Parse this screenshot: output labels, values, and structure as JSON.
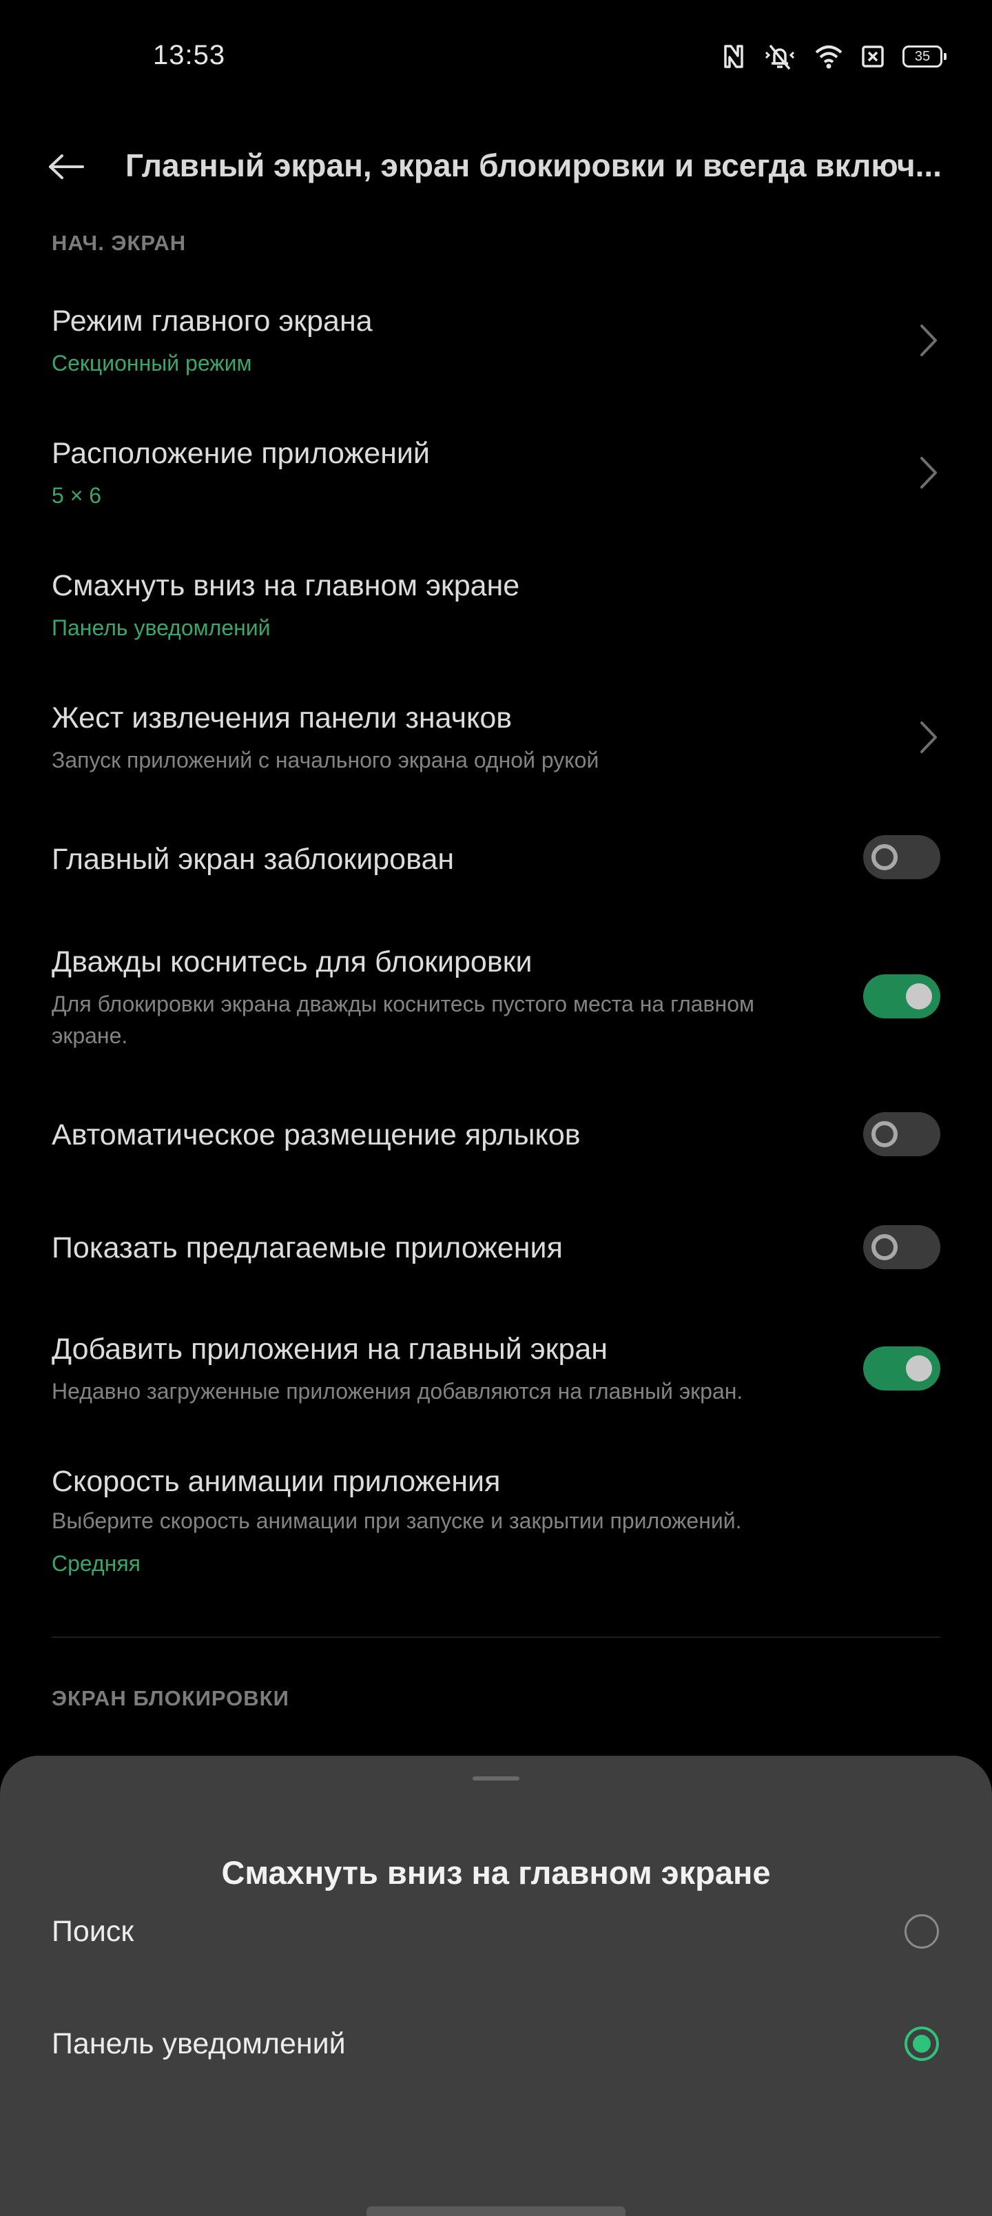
{
  "status_bar": {
    "time": "13:53",
    "battery": "35",
    "icons": [
      "nfc-icon",
      "silent-icon",
      "wifi-icon",
      "sim-error-icon",
      "battery-icon"
    ]
  },
  "header": {
    "back_icon": "arrow-left-icon",
    "title": "Главный экран, экран блокировки и всегда включ..."
  },
  "sections": {
    "home": "НАЧ. ЭКРАН",
    "lock": "ЭКРАН БЛОКИРОВКИ"
  },
  "settings": {
    "home_mode": {
      "title": "Режим главного экрана",
      "value": "Секционный режим"
    },
    "app_layout": {
      "title": "Расположение приложений",
      "value": "5 × 6"
    },
    "swipe_down": {
      "title": "Смахнуть вниз на главном экране",
      "value": "Панель уведомлений"
    },
    "icon_gesture": {
      "title": "Жест извлечения панели значков",
      "subtitle": "Запуск приложений с начального экрана одной рукой"
    },
    "home_locked": {
      "title": "Главный экран заблокирован",
      "enabled": false
    },
    "double_tap_lock": {
      "title": "Дважды коснитесь для блокировки",
      "subtitle": "Для блокировки экрана дважды коснитесь пустого места на главном экране.",
      "enabled": true
    },
    "auto_shortcuts": {
      "title": "Автоматическое размещение ярлыков",
      "enabled": false
    },
    "suggested_apps": {
      "title": "Показать предлагаемые приложения",
      "enabled": false
    },
    "add_to_home": {
      "title": "Добавить приложения на главный экран",
      "subtitle": "Недавно загруженные приложения добавляются на главный экран.",
      "enabled": true
    },
    "animation_speed": {
      "title": "Скорость анимации приложения",
      "subtitle": "Выберите скорость анимации при запуске и закрытии приложений.",
      "value": "Средняя"
    }
  },
  "sheet": {
    "title": "Смахнуть вниз на главном экране",
    "options": [
      {
        "label": "Поиск",
        "selected": false
      },
      {
        "label": "Панель уведомлений",
        "selected": true
      }
    ]
  },
  "colors": {
    "background": "#000000",
    "accent": "#3aa66a",
    "toggle_on": "#1f8a53",
    "sheet": "#3f3f3f"
  }
}
